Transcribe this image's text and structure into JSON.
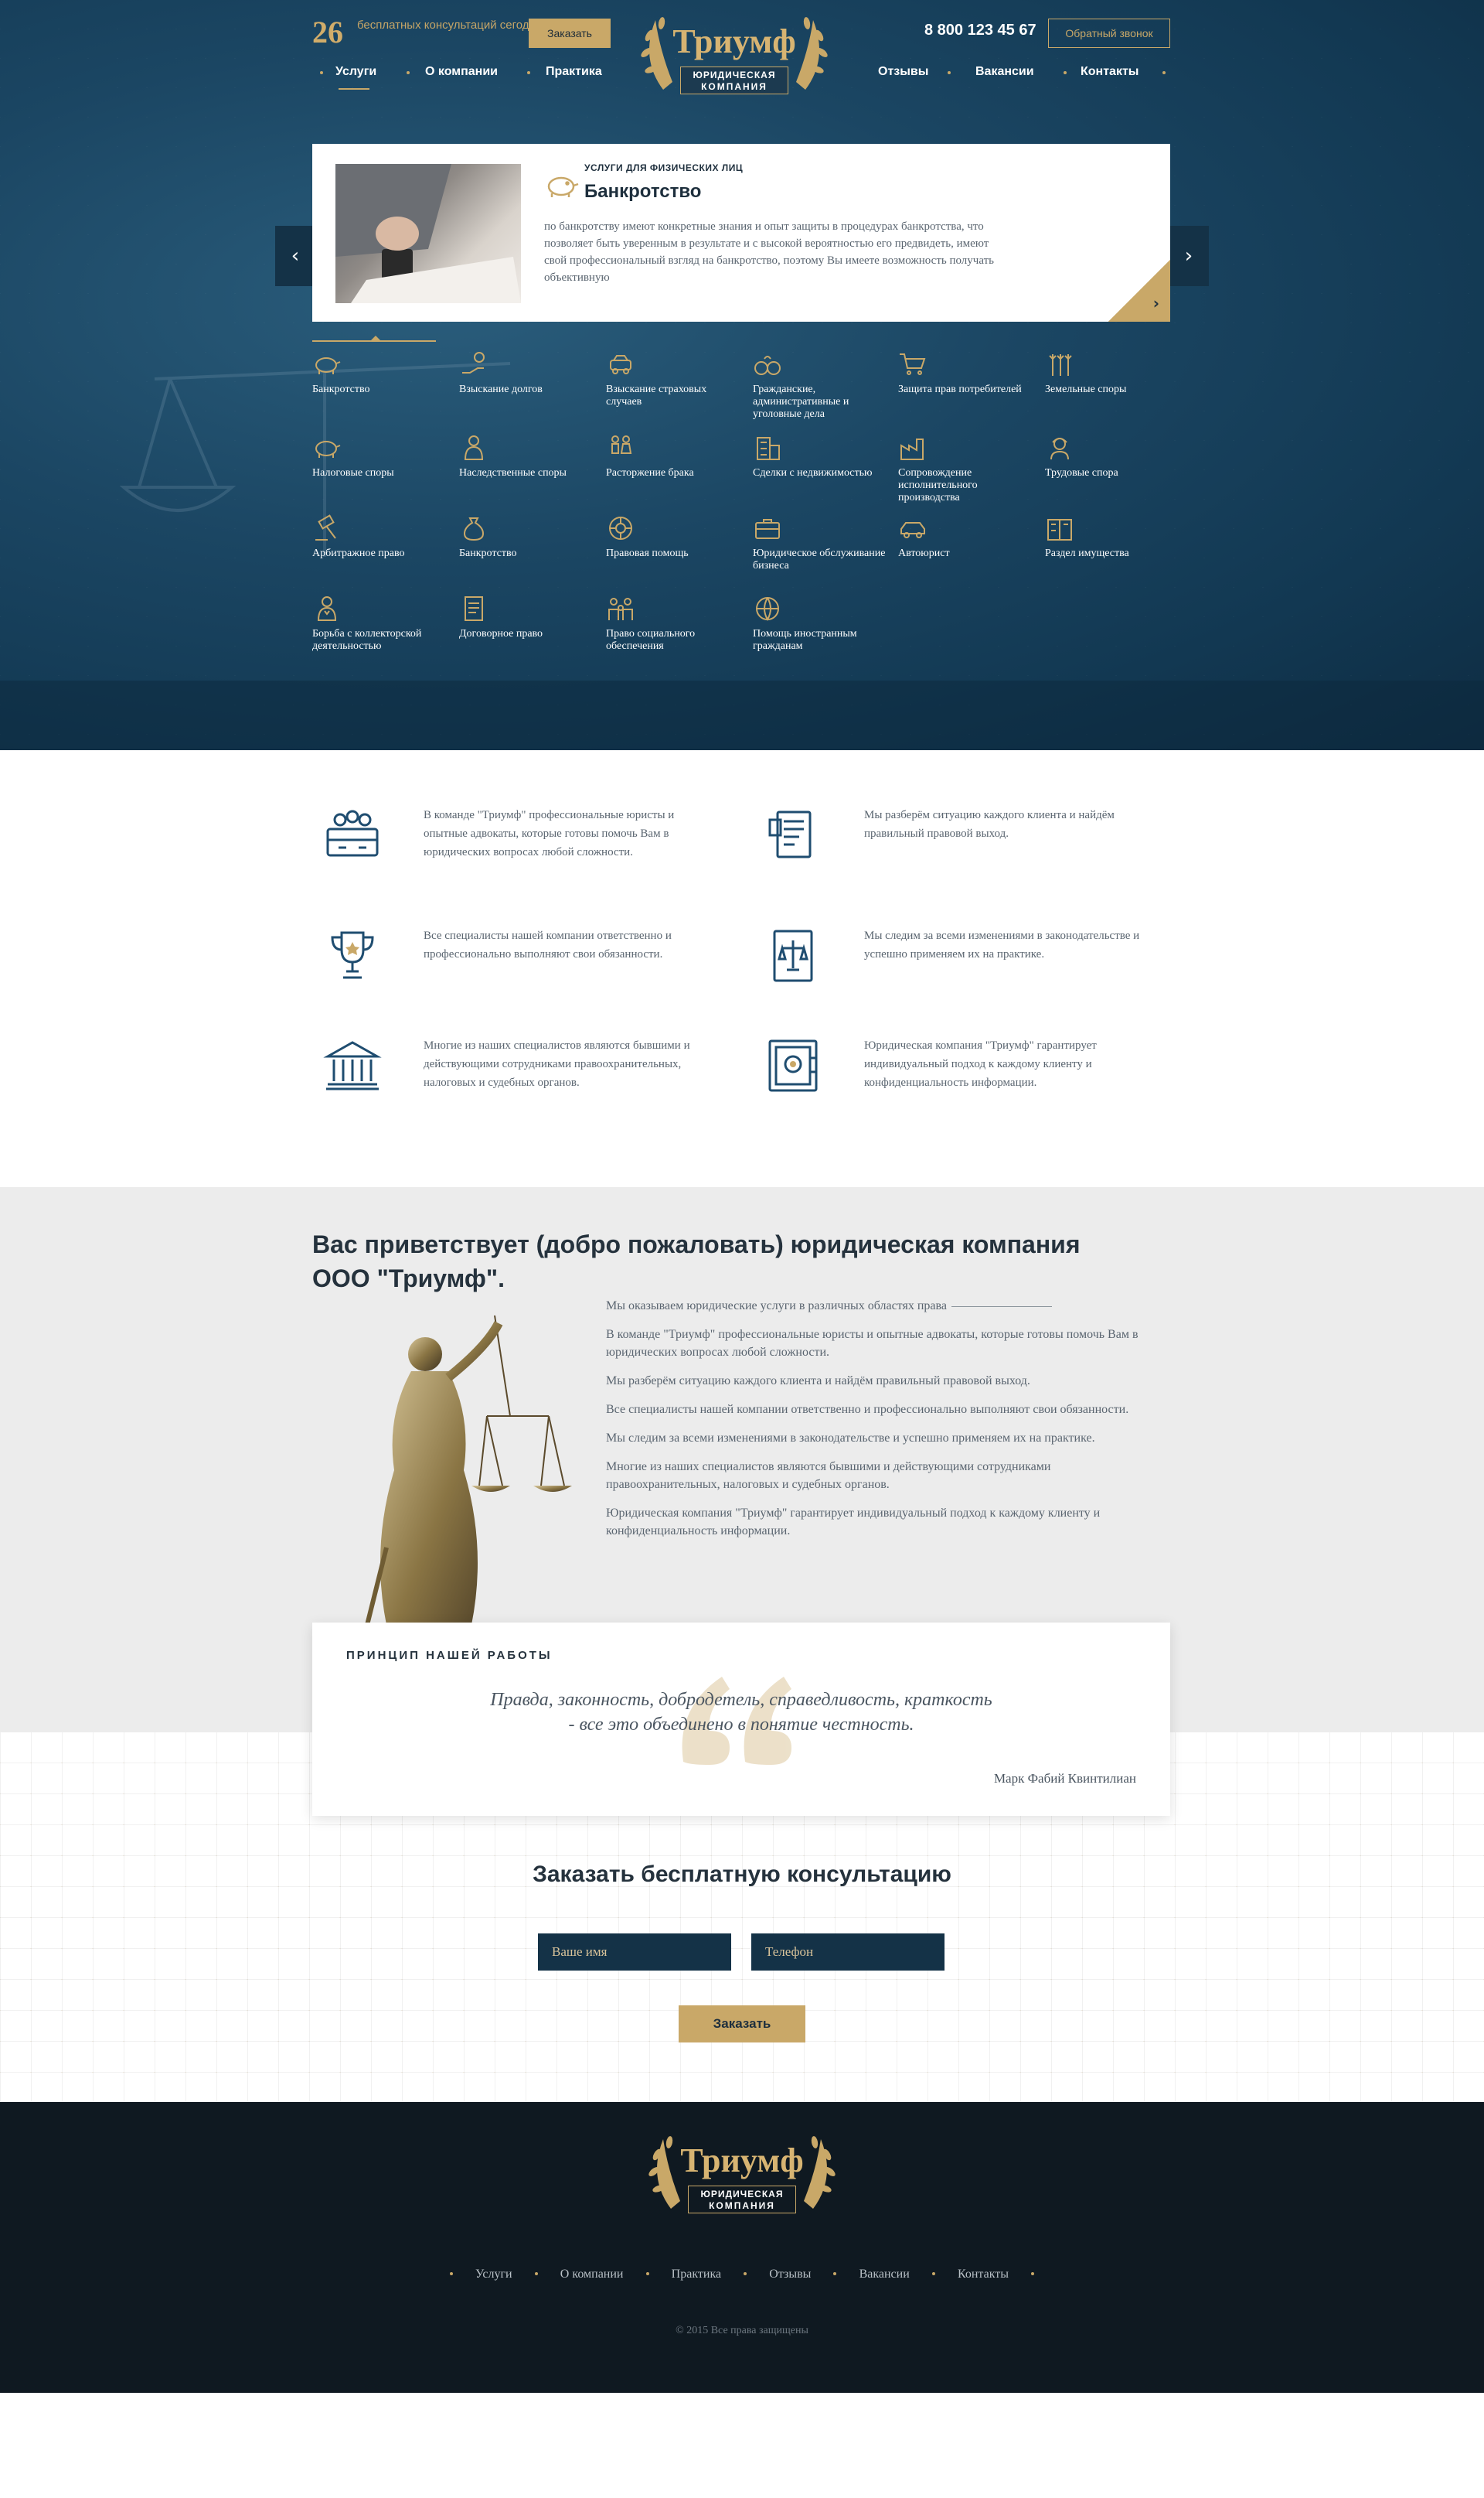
{
  "header": {
    "counter_number": "26",
    "counter_text": "бесплатных консультаций сегодня",
    "order_label": "Заказать",
    "logo_title": "Триумф",
    "logo_subtitle_1": "юридическая",
    "logo_subtitle_2": "компания",
    "phone": "8 800 123 45 67",
    "callback_label": "Обратный звонок"
  },
  "nav": [
    "Услуги",
    "О компании",
    "Практика",
    "Отзывы",
    "Вакансии",
    "Контакты"
  ],
  "slide": {
    "category": "УСЛУГИ ДЛЯ ФИЗИЧЕСКИХ ЛИЦ",
    "title": "Банкротство",
    "text": "по банкротству имеют конкретные знания и опыт защиты в процедурах банкротства, что позволяет быть уверенным в результате и с высокой вероятностью его предвидеть, имеют свой профессиональный взгляд на банкротство, поэтому Вы имеете возможность получать объективную",
    "prev_label": "‹",
    "next_label": "›",
    "corner_arrow": "›"
  },
  "services": [
    {
      "label": "Банкротство",
      "icon": "piggy-bank-icon"
    },
    {
      "label": "Взыскание долгов",
      "icon": "hand-coin-icon"
    },
    {
      "label": "Взыскание страховых случаев",
      "icon": "car-crash-icon"
    },
    {
      "label": "Гражданские, административные и уголовные дела",
      "icon": "handcuffs-icon"
    },
    {
      "label": "Защита прав потребителей",
      "icon": "cart-icon"
    },
    {
      "label": "Земельные споры",
      "icon": "wheat-icon"
    },
    {
      "label": "Налоговые споры",
      "icon": "piggy-bank-icon"
    },
    {
      "label": "Наследственные споры",
      "icon": "people-icon"
    },
    {
      "label": "Расторжение брака",
      "icon": "couple-icon"
    },
    {
      "label": "Сделки с недвижимостью",
      "icon": "building-icon"
    },
    {
      "label": "Сопровождение исполнительного производства",
      "icon": "factory-icon"
    },
    {
      "label": "Трудовые спора",
      "icon": "worker-icon"
    },
    {
      "label": "Арбитражное право",
      "icon": "gavel-icon"
    },
    {
      "label": "Банкротство",
      "icon": "money-bag-icon"
    },
    {
      "label": "Правовая помощь",
      "icon": "lifebuoy-icon"
    },
    {
      "label": "Юридическое обслуживание бизнеса",
      "icon": "briefcase-icon"
    },
    {
      "label": "Автоюрист",
      "icon": "car-icon"
    },
    {
      "label": "Раздел имущества",
      "icon": "house-split-icon"
    },
    {
      "label": "Борьба с коллекторской деятельностью",
      "icon": "collector-icon"
    },
    {
      "label": "Договорное право",
      "icon": "contract-icon"
    },
    {
      "label": "Право социального обеспечения",
      "icon": "family-icon"
    },
    {
      "label": "Помощь иностранным гражданам",
      "icon": "globe-icon"
    }
  ],
  "features": [
    {
      "icon": "team-icon",
      "text": "В команде \"Триумф\" профессиональные юристы и опытные адвокаты, которые готовы помочь Вам в юридических вопросах любой сложности."
    },
    {
      "icon": "document-icon",
      "text": "Мы разберём ситуацию каждого клиента и найдём правильный правовой выход."
    },
    {
      "icon": "trophy-icon",
      "text": "Все специалисты нашей компании ответственно и профессионально выполняют свои обязанности."
    },
    {
      "icon": "law-book-icon",
      "text": "Мы следим за всеми изменениями в законодательстве и успешно применяем их на практике."
    },
    {
      "icon": "courthouse-icon",
      "text": "Многие из наших специалистов являются бывшими и действующими сотрудниками правоохранительных, налоговых и судебных органов."
    },
    {
      "icon": "safe-icon",
      "text": "Юридическая компания \"Триумф\" гарантирует индивидуальный подход к каждому клиенту и конфиденциальность информации."
    }
  ],
  "about": {
    "title": "Вас приветствует (добро пожаловать) юридическая компания ООО \"Триумф\".",
    "paragraphs": [
      "Мы оказываем юридические услуги в различных областях права",
      "В команде \"Триумф\" профессиональные юристы и опытные адвокаты, которые готовы помочь Вам в юридических вопросах любой сложности.",
      "Мы разберём ситуацию каждого клиента и найдём правильный правовой выход.",
      "Все специалисты нашей компании ответственно и профессионально выполняют свои обязанности.",
      "Мы следим за всеми изменениями в законодательстве и успешно применяем их на практике.",
      "Многие из наших специалистов являются бывшими и действующими сотрудниками правоохранительных, налоговых и судебных органов.",
      "Юридическая компания \"Триумф\" гарантирует индивидуальный подход к каждому клиенту и конфиденциальность информации."
    ]
  },
  "quote": {
    "heading": "ПРИНЦИП НАШЕЙ РАБОТЫ",
    "text": "Правда, законность, добродетель, справедливость, краткость - все это объединено в понятие честность.",
    "author": "Марк Фабий Квинтилиан"
  },
  "form": {
    "title": "Заказать бесплатную консультацию",
    "name_placeholder": "Ваше имя",
    "phone_placeholder": "Телефон",
    "submit_label": "Заказать"
  },
  "footer": {
    "nav": [
      "Услуги",
      "О компании",
      "Практика",
      "Отзывы",
      "Вакансии",
      "Контакты"
    ],
    "copyright": "© 2015 Все права защищены"
  },
  "colors": {
    "gold": "#c9a868",
    "navy": "#143247",
    "footer_bg": "#0f1921",
    "section_gray": "#ececec"
  }
}
